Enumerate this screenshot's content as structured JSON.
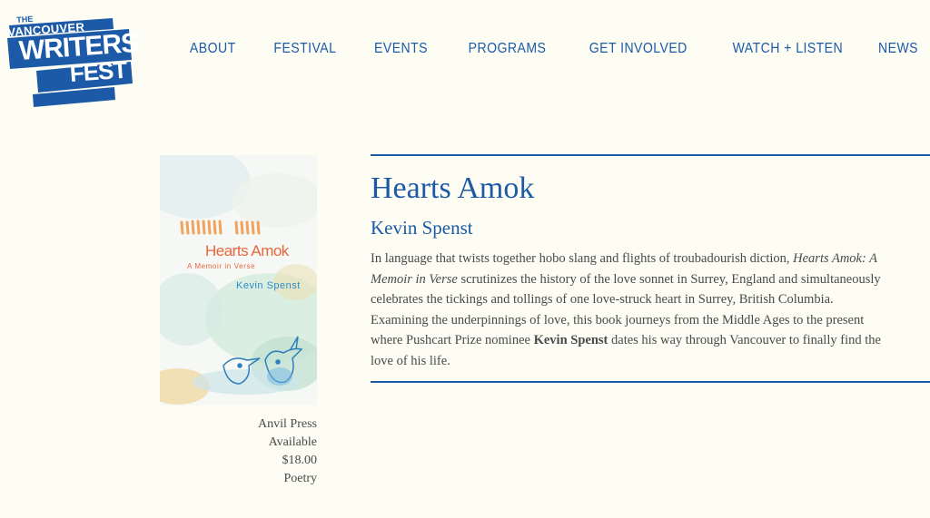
{
  "logo": {
    "line1": "THE",
    "line2": "VANCOUVER",
    "line3": "WRITERS",
    "line4": "FEST"
  },
  "nav": {
    "items": [
      "ABOUT",
      "FESTIVAL",
      "EVENTS",
      "PROGRAMS",
      "GET INVOLVED",
      "WATCH + LISTEN",
      "NEWS"
    ]
  },
  "book": {
    "title": "Hearts Amok",
    "author": "Kevin Spenst",
    "cover": {
      "title": "Hearts Amok",
      "subtitle": "A Memoir in Verse",
      "author": "Kevin Spenst"
    },
    "description": {
      "part1": "In language that twists together hobo slang and flights of troubadourish diction, ",
      "italic": "Hearts Amok: A Memoir in Verse",
      "part2": " scrutinizes the history of the love sonnet in Surrey, England and simultaneously celebrates the tickings and tollings of one love-struck heart in Surrey, British Columbia. Examining the underpinnings of love, this book journeys from the Middle Ages to the present where Pushcart Prize nominee ",
      "bold": "Kevin Spenst",
      "part3": " dates his way through Vancouver to finally find the love of his life."
    },
    "publisher": "Anvil Press",
    "availability": "Available",
    "price": "$18.00",
    "genre": "Poetry"
  },
  "colors": {
    "brand_blue": "#1c5aa8",
    "background": "#fdfdf3",
    "text": "#4a4a4a"
  }
}
